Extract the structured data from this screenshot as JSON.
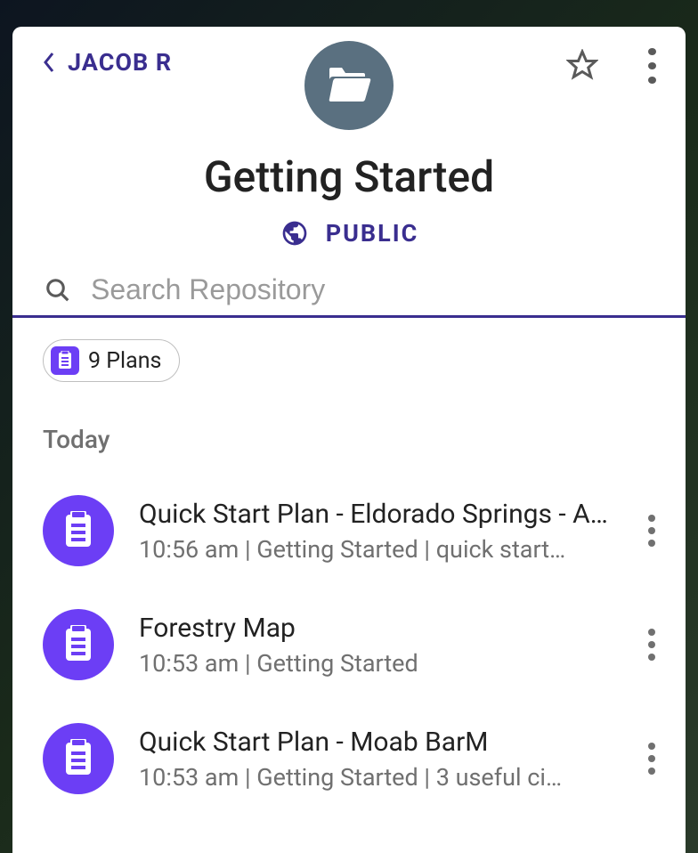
{
  "breadcrumb": {
    "label": "JACOB R"
  },
  "header": {
    "title": "Getting Started",
    "visibility_label": "PUBLIC"
  },
  "search": {
    "placeholder": "Search Repository",
    "value": ""
  },
  "filter": {
    "label": "9 Plans"
  },
  "section": {
    "label": "Today"
  },
  "items": [
    {
      "title": "Quick Start Plan - Eldorado Springs - A…",
      "subtitle": "10:56 am | Getting Started | quick start…"
    },
    {
      "title": "Forestry Map",
      "subtitle": "10:53 am | Getting Started"
    },
    {
      "title": "Quick Start Plan - Moab BarM",
      "subtitle": "10:53 am | Getting Started | 3 useful ci…"
    }
  ]
}
